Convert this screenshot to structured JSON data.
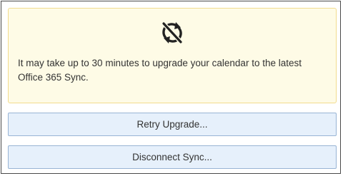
{
  "notice": {
    "icon": "sync-disabled-icon",
    "message": "It may take up to 30 minutes to upgrade your calendar to the latest Office 365 Sync."
  },
  "actions": {
    "retry_label": "Retry Upgrade...",
    "disconnect_label": "Disconnect Sync..."
  },
  "colors": {
    "notice_background": "#fefbe6",
    "notice_border": "#f2dc8e",
    "button_background": "#e6f0fb",
    "button_border": "#98b4d4",
    "text": "#333333"
  }
}
